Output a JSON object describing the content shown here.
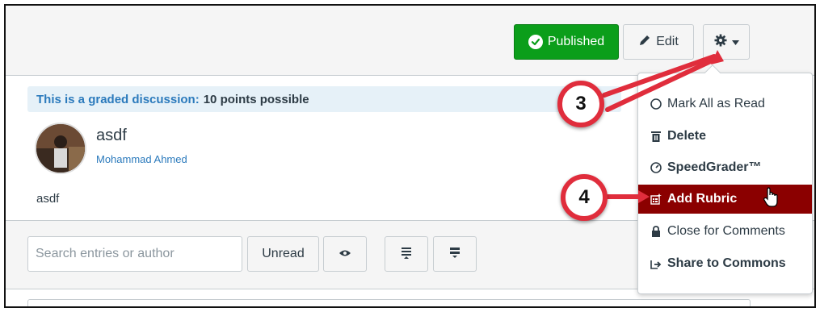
{
  "header": {
    "published_label": "Published",
    "edit_label": "Edit",
    "settings_icon": "gear-icon",
    "caret_icon": "caret-down-icon"
  },
  "banner": {
    "lead": "This is a graded discussion:",
    "rest": "10 points possible"
  },
  "post": {
    "title": "asdf",
    "author": "Mohammad Ahmed",
    "body": "asdf"
  },
  "toolbar": {
    "search_placeholder": "Search entries or author",
    "unread_label": "Unread",
    "eye_icon": "eye-icon",
    "expand_icon": "expand-icon",
    "collapse_icon": "collapse-icon"
  },
  "menu": {
    "items": [
      {
        "label": "Mark All as Read",
        "icon": "circle-icon"
      },
      {
        "label": "Delete",
        "icon": "trash-icon"
      },
      {
        "label": "SpeedGrader™",
        "icon": "speedometer-icon"
      },
      {
        "label": "Add Rubric",
        "icon": "rubric-icon",
        "active": true
      },
      {
        "label": "Close for Comments",
        "icon": "lock-icon"
      },
      {
        "label": "Share to Commons",
        "icon": "share-icon"
      }
    ]
  },
  "callouts": {
    "step_a": "3",
    "step_b": "4"
  },
  "colors": {
    "published_green": "#0b9e1a",
    "active_menu": "#8b0000",
    "callout_red": "#e02d3c",
    "link_blue": "#2b7abc",
    "banner_bg": "#e6f1f8"
  }
}
